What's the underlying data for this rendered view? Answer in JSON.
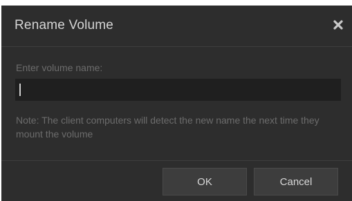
{
  "dialog": {
    "title": "Rename Volume",
    "close_icon": "close-icon",
    "field_label": "Enter volume name:",
    "field_value": "",
    "note": "Note: The client computers will detect the new name the next time they mount the volume",
    "ok_label": "OK",
    "cancel_label": "Cancel"
  },
  "colors": {
    "dialog_background": "#2d2d2d",
    "input_background": "#1f1f1f",
    "button_background": "#3d3d3d",
    "title_text": "#d6d6d6",
    "muted_text": "#6c6c6c"
  }
}
